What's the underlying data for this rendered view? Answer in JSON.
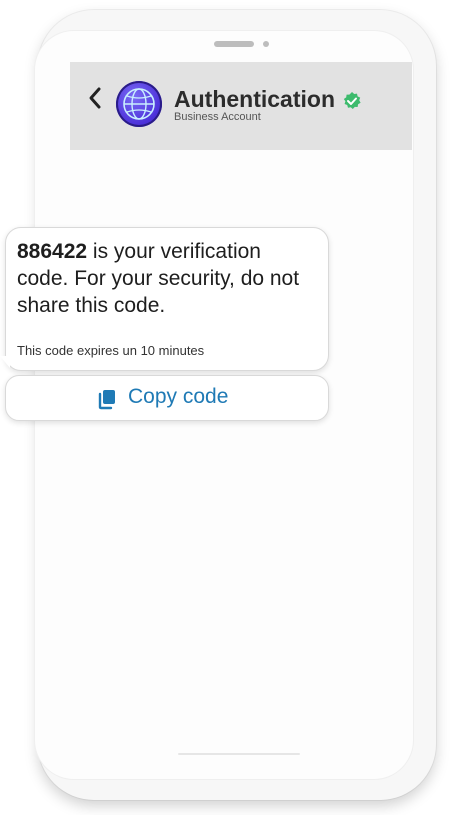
{
  "header": {
    "back_icon": "chevron-left-icon",
    "avatar_icon": "globe-icon",
    "title": "Authentication",
    "subtitle": "Business Account",
    "verified_icon": "verified-badge-icon",
    "verified_color": "#3dbb6d"
  },
  "message": {
    "code": "886422",
    "body": " is your verification code. For your security, do not share this code.",
    "expiry": "This code expires un 10 minutes"
  },
  "copy_button": {
    "label": "Copy code",
    "icon": "copy-icon",
    "color": "#1f7ab5"
  },
  "colors": {
    "header_bg": "#e2e2e2",
    "avatar": "#4a2fd8"
  }
}
